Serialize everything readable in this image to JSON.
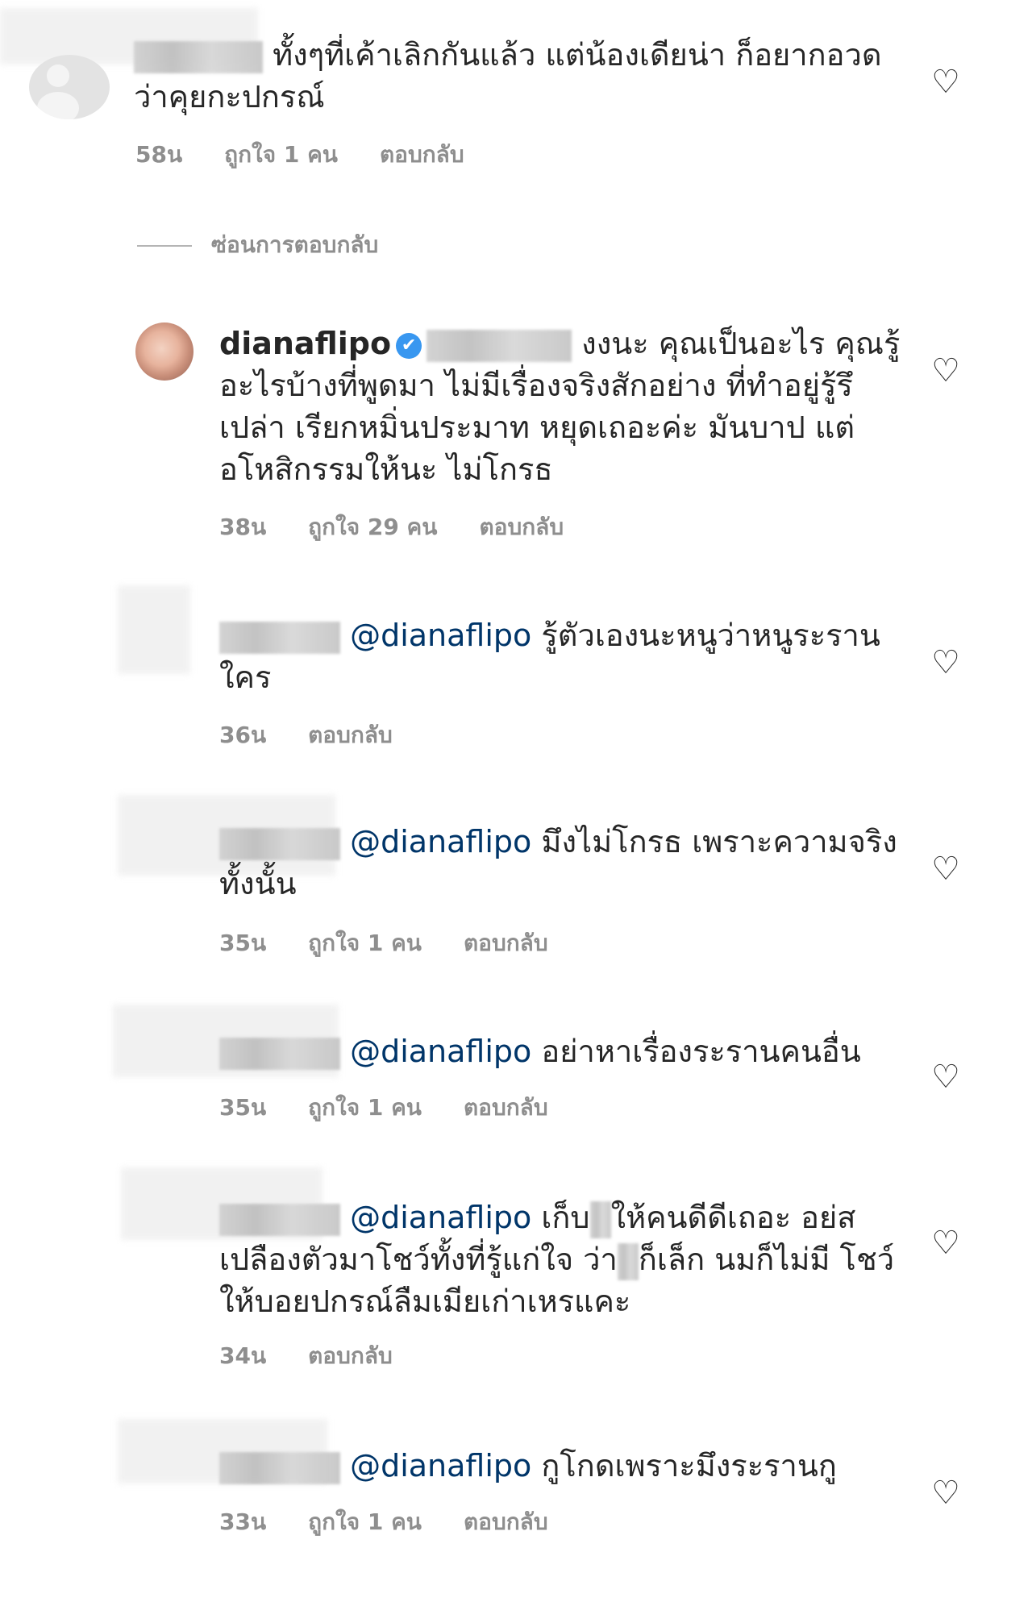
{
  "comments": [
    {
      "text_line1": "ทั้งๆที่เค้าเลิกกันแล้ว แต่น้องเดียน่า ก็อยากอวด",
      "text_line2": "ว่าคุยกะปกรณ์",
      "time": "58น",
      "likes": "ถูกใจ 1 คน",
      "reply": "ตอบกลับ"
    },
    {
      "username": "dianaflipo",
      "verified_icon": "✔",
      "text_line1": "งงนะ คุณเป็นอะไร คุณรู้",
      "text_line2": "อะไรบ้างที่พูดมา ไม่มีเรื่องจริงสักอย่าง ที่ทำอยู่รู้รึ",
      "text_line3": "เปล่า เรียกหมิ่นประมาท หยุดเถอะค่ะ มันบาป แต่",
      "text_line4": "อโหสิกรรมให้นะ ไม่โกรธ",
      "time": "38น",
      "likes": "ถูกใจ 29 คน",
      "reply": "ตอบกลับ"
    },
    {
      "mention": "@dianaflipo",
      "text_line1": "รู้ตัวเองนะหนูว่าหนูระราน",
      "text_line2": "ใคร",
      "time": "36น",
      "reply": "ตอบกลับ"
    },
    {
      "mention": "@dianaflipo",
      "text_line1": "มึงไม่โกรธ เพราะความจริง",
      "text_line2": "ทั้งนั้น",
      "time": "35น",
      "likes": "ถูกใจ 1 คน",
      "reply": "ตอบกลับ"
    },
    {
      "mention": "@dianaflipo",
      "text_line1": "อย่าหาเรื่องระรานคนอื่น",
      "time": "35น",
      "likes": "ถูกใจ 1 คน",
      "reply": "ตอบกลับ"
    },
    {
      "mention": "@dianaflipo",
      "text_line1a": "เก็บ",
      "text_line1b": "ให้คนดีดีเถอะ อย่ส",
      "text_line2a": "เปลืองตัวมาโชว์ทั้งที่รู้แก่ใจ ว่า",
      "text_line2b": "ก็เล็ก นมก็ไม่มี โชว์",
      "text_line3": "ให้บอยปกรณ์ลืมเมียเก่าเหรแคะ",
      "time": "34น",
      "reply": "ตอบกลับ"
    },
    {
      "mention": "@dianaflipo",
      "text_line1": "กูโกดเพราะมึงระรานกู",
      "time": "33น",
      "likes": "ถูกใจ 1 คน",
      "reply": "ตอบกลับ"
    }
  ],
  "hide_replies": "ซ่อนการตอบกลับ",
  "heart_icon": "♡"
}
